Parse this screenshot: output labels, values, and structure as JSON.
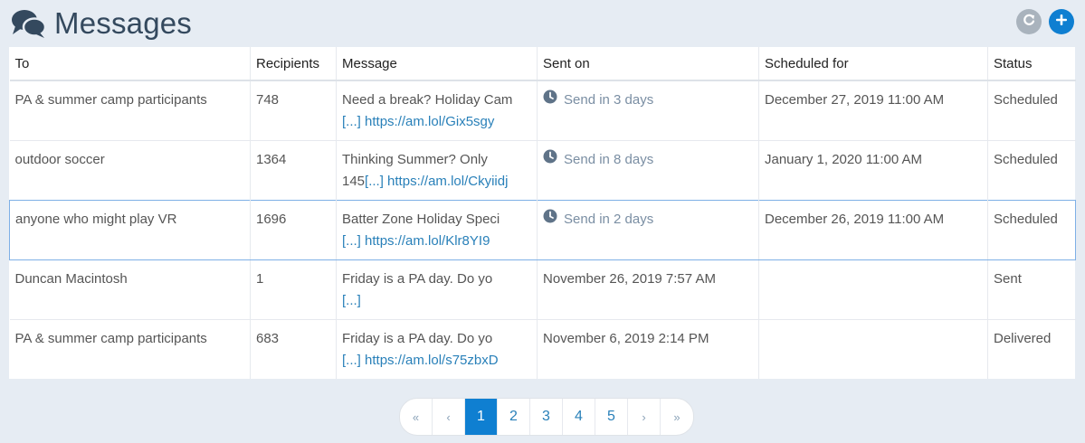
{
  "header": {
    "title": "Messages",
    "icon": "comments-icon",
    "refresh_icon": "refresh-icon",
    "add_icon": "plus-icon"
  },
  "colors": {
    "accent": "#0f7fd1",
    "link": "#2980b9",
    "muted_status": "#7a8ea3",
    "background": "#e6ecf3"
  },
  "table": {
    "columns": [
      "To",
      "Recipients",
      "Message",
      "Sent on",
      "Scheduled for",
      "Status"
    ],
    "rows": [
      {
        "to": "PA & summer camp participants",
        "recipients": "748",
        "message": "Need a break? Holiday Cam",
        "more": "[...]",
        "link": "https://am.lol/Gix5sgy",
        "sent_on": "Send in 3 days",
        "sent_on_pending": true,
        "scheduled_for": "December 27, 2019 11:00 AM",
        "status": "Scheduled"
      },
      {
        "to": "outdoor soccer",
        "recipients": "1364",
        "message": "Thinking Summer? Only 145",
        "more": "[...]",
        "link": "https://am.lol/Ckyiidj",
        "sent_on": "Send in 8 days",
        "sent_on_pending": true,
        "scheduled_for": "January 1, 2020 11:00 AM",
        "status": "Scheduled"
      },
      {
        "to": "anyone who might play VR",
        "recipients": "1696",
        "message": "Batter Zone Holiday Speci",
        "more": "[...]",
        "link": "https://am.lol/Klr8YI9",
        "sent_on": "Send in 2 days",
        "sent_on_pending": true,
        "scheduled_for": "December 26, 2019 11:00 AM",
        "status": "Scheduled"
      },
      {
        "to": "Duncan Macintosh",
        "recipients": "1",
        "message": "Friday is a PA day. Do yo",
        "more": "[...]",
        "link": "",
        "sent_on": "November 26, 2019 7:57 AM",
        "sent_on_pending": false,
        "scheduled_for": "",
        "status": "Sent"
      },
      {
        "to": "PA & summer camp participants",
        "recipients": "683",
        "message": "Friday is a PA day. Do yo",
        "more": "[...]",
        "link": "https://am.lol/s75zbxD",
        "sent_on": "November 6, 2019 2:14 PM",
        "sent_on_pending": false,
        "scheduled_for": "",
        "status": "Delivered"
      }
    ]
  },
  "pagination": {
    "first": "«",
    "prev": "‹",
    "pages": [
      "1",
      "2",
      "3",
      "4",
      "5"
    ],
    "current": "1",
    "next": "›",
    "last": "»"
  }
}
